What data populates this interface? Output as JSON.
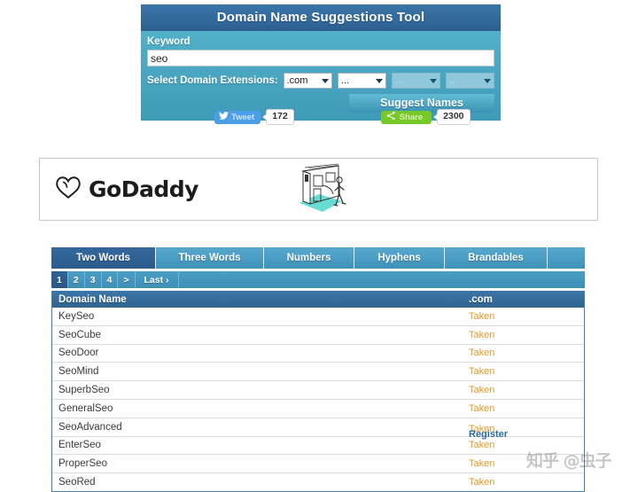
{
  "tool": {
    "title": "Domain Name Suggestions Tool",
    "keyword_label": "Keyword",
    "keyword_value": "seo",
    "keyword_placeholder": "",
    "extensions_label": "Select Domain Extensions:",
    "extension_selects": [
      {
        "value": ".com",
        "enabled": true
      },
      {
        "value": "...",
        "enabled": true
      },
      {
        "value": "...",
        "enabled": false
      },
      {
        "value": "...",
        "enabled": false
      }
    ],
    "suggest_label": "Suggest Names"
  },
  "social": {
    "tweet_label": "Tweet",
    "tweet_count": "172",
    "share_label": "Share",
    "share_count": "2300",
    "tweet_icon": "twitter-bird-icon",
    "share_icon": "share-network-icon"
  },
  "ad": {
    "brand": "GoDaddy",
    "logo_icon": "godaddy-heart-logo-icon",
    "illustration_icon": "storefront-walking-person-illustration"
  },
  "results": {
    "tabs": [
      {
        "label": "Two Words",
        "active": true,
        "width": 118
      },
      {
        "label": "Three Words",
        "active": false,
        "width": 122
      },
      {
        "label": "Numbers",
        "active": false,
        "width": 102
      },
      {
        "label": "Hyphens",
        "active": false,
        "width": 102
      },
      {
        "label": "Brandables",
        "active": false,
        "width": 116
      }
    ],
    "pagination": [
      {
        "label": "1",
        "active": true
      },
      {
        "label": "2",
        "active": false
      },
      {
        "label": "3",
        "active": false
      },
      {
        "label": "4",
        "active": false
      },
      {
        "label": ">",
        "active": false
      },
      {
        "label": "Last ›",
        "active": false
      }
    ],
    "columns": {
      "name": "Domain Name",
      "extension": ".com"
    },
    "rows": [
      {
        "name": "KeySeo",
        "status": "Taken"
      },
      {
        "name": "SeoCube",
        "status": "Taken"
      },
      {
        "name": "SeoDoor",
        "status": "Taken"
      },
      {
        "name": "SeoMind",
        "status": "Taken"
      },
      {
        "name": "SuperbSeo",
        "status": "Taken"
      },
      {
        "name": "GeneralSeo",
        "status": "Taken"
      },
      {
        "name": "SeoAdvanced",
        "status": "Taken",
        "status_alt": "Register",
        "overlap": true
      },
      {
        "name": "EnterSeo",
        "status": "Taken"
      },
      {
        "name": "ProperSeo",
        "status": "Taken"
      },
      {
        "name": "SeoRed",
        "status": "Taken"
      }
    ]
  },
  "watermark": {
    "text": "知乎 @虫子"
  },
  "colors": {
    "title_bar": "#2d5f91",
    "panel_body": "#4aa4c0",
    "tab_active": "#2b5a8b",
    "tab_inactive": "#45 9 8bd",
    "table_header": "#34689a",
    "status_taken": "#e8992b",
    "status_register": "#2b6aa8",
    "tweet_blue": "#4a9fe8",
    "share_green": "#76c927"
  }
}
